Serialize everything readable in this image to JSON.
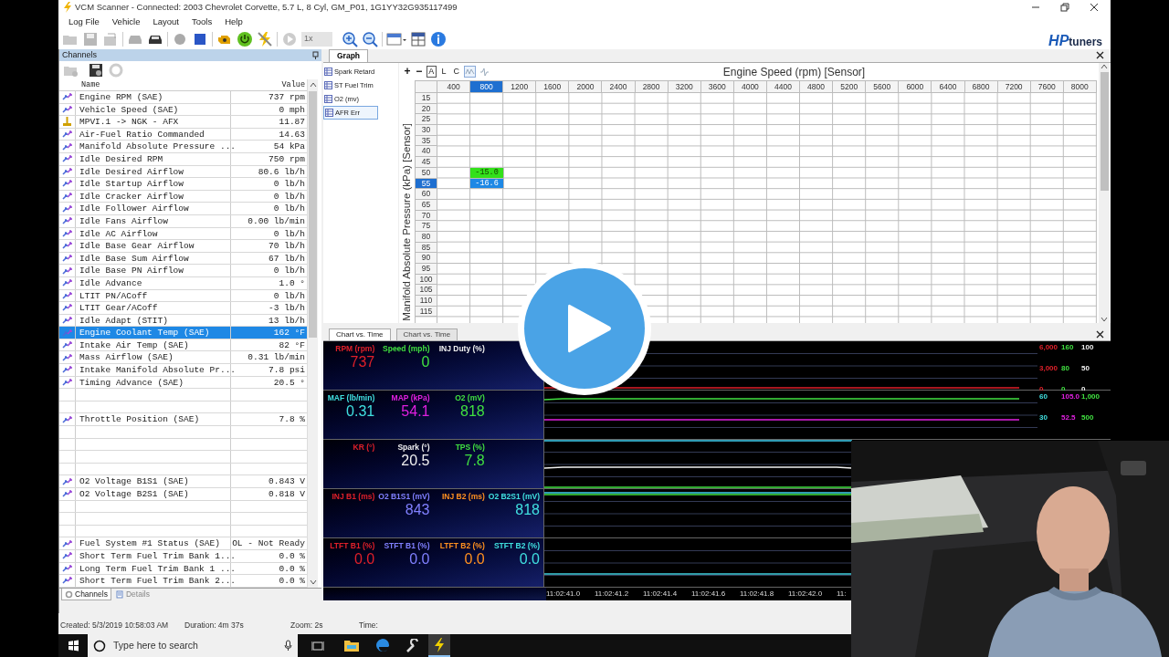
{
  "window": {
    "title": "VCM Scanner - Connected: 2003 Chevrolet Corvette, 5.7 L, 8 Cyl, GM_P01, 1G1YY32G935117499"
  },
  "menu": [
    "Log File",
    "Vehicle",
    "Layout",
    "Tools",
    "Help"
  ],
  "toolbar": {
    "playback_speed": {
      "value": "1x",
      "disabled": true
    }
  },
  "brand": {
    "prefix": "HP",
    "suffix": "tuners"
  },
  "channels_panel": {
    "title": "Channels",
    "columns": [
      "Name",
      "Value"
    ],
    "rows": [
      {
        "kind": "channel",
        "name": "Engine RPM (SAE)",
        "value": "737 rpm",
        "selected": false
      },
      {
        "kind": "channel",
        "name": "Vehicle Speed (SAE)",
        "value": "0 mph",
        "selected": false
      },
      {
        "kind": "probe",
        "name": "MPVI.1 -> NGK - AFX",
        "value": "11.87",
        "selected": false
      },
      {
        "kind": "channel",
        "name": "Air-Fuel Ratio Commanded",
        "value": "14.63",
        "selected": false
      },
      {
        "kind": "channel",
        "name": "Manifold Absolute Pressure ...",
        "value": "54 kPa",
        "selected": false
      },
      {
        "kind": "channel",
        "name": "Idle Desired RPM",
        "value": "750 rpm",
        "selected": false
      },
      {
        "kind": "channel",
        "name": "Idle Desired Airflow",
        "value": "80.6 lb/h",
        "selected": false
      },
      {
        "kind": "channel",
        "name": "Idle Startup Airflow",
        "value": "0 lb/h",
        "selected": false
      },
      {
        "kind": "channel",
        "name": "Idle Cracker Airflow",
        "value": "0 lb/h",
        "selected": false
      },
      {
        "kind": "channel",
        "name": "Idle Follower Airflow",
        "value": "0 lb/h",
        "selected": false
      },
      {
        "kind": "channel",
        "name": "Idle Fans Airflow",
        "value": "0.00 lb/min",
        "selected": false
      },
      {
        "kind": "channel",
        "name": "Idle AC Airflow",
        "value": "0 lb/h",
        "selected": false
      },
      {
        "kind": "channel",
        "name": "Idle Base Gear Airflow",
        "value": "70 lb/h",
        "selected": false
      },
      {
        "kind": "channel",
        "name": "Idle Base Sum Airflow",
        "value": "67 lb/h",
        "selected": false
      },
      {
        "kind": "channel",
        "name": "Idle Base PN Airflow",
        "value": "0 lb/h",
        "selected": false
      },
      {
        "kind": "channel",
        "name": "Idle Advance",
        "value": "1.0 °",
        "selected": false
      },
      {
        "kind": "channel",
        "name": "LTIT PN/ACoff",
        "value": "0 lb/h",
        "selected": false
      },
      {
        "kind": "channel",
        "name": "LTIT Gear/ACoff",
        "value": "-3 lb/h",
        "selected": false
      },
      {
        "kind": "channel",
        "name": "Idle Adapt (STIT)",
        "value": "13 lb/h",
        "selected": false
      },
      {
        "kind": "channel",
        "name": "Engine Coolant Temp (SAE)",
        "value": "162 °F",
        "selected": true
      },
      {
        "kind": "channel",
        "name": "Intake Air Temp (SAE)",
        "value": "82 °F",
        "selected": false
      },
      {
        "kind": "channel",
        "name": "Mass Airflow (SAE)",
        "value": "0.31 lb/min",
        "selected": false
      },
      {
        "kind": "channel",
        "name": "Intake Manifold Absolute Pr...",
        "value": "7.8 psi",
        "selected": false
      },
      {
        "kind": "channel",
        "name": "Timing Advance (SAE)",
        "value": "20.5 °",
        "selected": false
      },
      {
        "kind": "blank",
        "selected": false
      },
      {
        "kind": "blank",
        "selected": false
      },
      {
        "kind": "channel",
        "name": "Throttle Position (SAE)",
        "value": "7.8 %",
        "selected": false
      },
      {
        "kind": "blank",
        "selected": false
      },
      {
        "kind": "blank",
        "selected": false
      },
      {
        "kind": "blank",
        "selected": false
      },
      {
        "kind": "blank",
        "selected": false
      },
      {
        "kind": "channel",
        "name": "O2 Voltage B1S1 (SAE)",
        "value": "0.843 V",
        "selected": false
      },
      {
        "kind": "channel",
        "name": "O2 Voltage B2S1 (SAE)",
        "value": "0.818 V",
        "selected": false
      },
      {
        "kind": "blank",
        "selected": false
      },
      {
        "kind": "blank",
        "selected": false
      },
      {
        "kind": "blank",
        "selected": false
      },
      {
        "kind": "channel",
        "name": "Fuel System #1 Status (SAE)",
        "value": "OL - Not Ready",
        "selected": false
      },
      {
        "kind": "channel",
        "name": "Short Term Fuel Trim Bank 1...",
        "value": "0.0 %",
        "selected": false
      },
      {
        "kind": "channel",
        "name": "Long Term Fuel Trim Bank 1 ...",
        "value": "0.0 %",
        "selected": false
      },
      {
        "kind": "channel",
        "name": "Short Term Fuel Trim Bank 2...",
        "value": "0.0 %",
        "selected": false
      }
    ],
    "tabs": [
      {
        "label": "Channels",
        "selected": true
      },
      {
        "label": "Details",
        "selected": false
      }
    ]
  },
  "graph_panel": {
    "tab": "Graph",
    "tables": [
      {
        "label": "Spark Retard",
        "selected": false
      },
      {
        "label": "ST Fuel Trim",
        "selected": false
      },
      {
        "label": "O2 (mv)",
        "selected": false
      },
      {
        "label": "AFR Err",
        "selected": true
      }
    ],
    "zoom_buttons": [
      "+",
      "−"
    ],
    "modes": [
      {
        "label": "A",
        "selected": true
      },
      {
        "label": "L",
        "selected": false
      },
      {
        "label": "C",
        "selected": false
      }
    ],
    "trace_toggles": [
      {
        "selected": true
      },
      {
        "selected": false
      }
    ],
    "title": "Engine Speed (rpm) [Sensor]",
    "y_axis_label": "Manifold Absolute Pressure (kPa) [Sensor]",
    "columns": [
      {
        "label": "400",
        "selected": false
      },
      {
        "label": "800",
        "selected": true
      },
      {
        "label": "1200",
        "selected": false
      },
      {
        "label": "1600",
        "selected": false
      },
      {
        "label": "2000",
        "selected": false
      },
      {
        "label": "2400",
        "selected": false
      },
      {
        "label": "2800",
        "selected": false
      },
      {
        "label": "3200",
        "selected": false
      },
      {
        "label": "3600",
        "selected": false
      },
      {
        "label": "4000",
        "selected": false
      },
      {
        "label": "4400",
        "selected": false
      },
      {
        "label": "4800",
        "selected": false
      },
      {
        "label": "5200",
        "selected": false
      },
      {
        "label": "5600",
        "selected": false
      },
      {
        "label": "6000",
        "selected": false
      },
      {
        "label": "6400",
        "selected": false
      },
      {
        "label": "6800",
        "selected": false
      },
      {
        "label": "7200",
        "selected": false
      },
      {
        "label": "7600",
        "selected": false
      },
      {
        "label": "8000",
        "selected": false
      }
    ],
    "rows": [
      {
        "label": "15",
        "selected": false
      },
      {
        "label": "20",
        "selected": false
      },
      {
        "label": "25",
        "selected": false
      },
      {
        "label": "30",
        "selected": false
      },
      {
        "label": "35",
        "selected": false
      },
      {
        "label": "40",
        "selected": false
      },
      {
        "label": "45",
        "selected": false
      },
      {
        "label": "50",
        "selected": false,
        "cells": [
          null,
          {
            "value": "-15.0",
            "color": "#33e01a"
          }
        ]
      },
      {
        "label": "55",
        "selected": true,
        "cells": [
          null,
          {
            "value": "-16.6"
          }
        ]
      },
      {
        "label": "60",
        "selected": false
      },
      {
        "label": "65",
        "selected": false
      },
      {
        "label": "70",
        "selected": false
      },
      {
        "label": "75",
        "selected": false
      },
      {
        "label": "80",
        "selected": false
      },
      {
        "label": "85",
        "selected": false
      },
      {
        "label": "90",
        "selected": false
      },
      {
        "label": "95",
        "selected": false
      },
      {
        "label": "100",
        "selected": false
      },
      {
        "label": "105",
        "selected": false
      },
      {
        "label": "110",
        "selected": false
      },
      {
        "label": "115",
        "selected": false
      }
    ]
  },
  "chart_panel": {
    "tabs": [
      {
        "label": "Chart vs. Time",
        "selected": true
      },
      {
        "label": "Chart vs. Time",
        "selected": false
      }
    ],
    "rows": [
      {
        "gauges": [
          {
            "label": "RPM (rpm)",
            "value": "737",
            "color": "#e0202a"
          },
          {
            "label": "Speed (mph)",
            "value": "0",
            "color": "#40e040"
          },
          {
            "label": "INJ Duty (%)",
            "color": "#f0f0f0"
          }
        ],
        "scale": [
          [
            {
              "text": "6,000",
              "color": "#e0202a"
            },
            {
              "text": "160",
              "color": "#40e040"
            },
            {
              "text": "100",
              "color": "#f0f0f0"
            }
          ],
          [
            {
              "text": "3,000",
              "color": "#e0202a"
            },
            {
              "text": "80",
              "color": "#40e040"
            },
            {
              "text": "50",
              "color": "#f0f0f0"
            }
          ],
          [
            {
              "text": "0",
              "color": "#e0202a"
            },
            {
              "text": "0",
              "color": "#40e040"
            },
            {
              "text": "0",
              "color": "#f0f0f0"
            }
          ]
        ]
      },
      {
        "gauges": [
          {
            "label": "MAF (lb/min)",
            "value": "0.31",
            "color": "#40e0e0"
          },
          {
            "label": "MAP (kPa)",
            "value": "54.1",
            "color": "#e020e0"
          },
          {
            "label": "O2 (mV)",
            "value": "818",
            "color": "#40e040"
          }
        ],
        "scale": [
          [
            {
              "text": "60",
              "color": "#40e0e0"
            },
            {
              "text": "105.0",
              "color": "#e020e0"
            },
            {
              "text": "1,000",
              "color": "#40e040"
            }
          ],
          [
            {
              "text": "30",
              "color": "#40e0e0"
            },
            {
              "text": "52.5",
              "color": "#e020e0"
            },
            {
              "text": "500",
              "color": "#40e040"
            }
          ]
        ]
      },
      {
        "gauges": [
          {
            "label": "KR (°)",
            "color": "#e0202a"
          },
          {
            "label": "Spark (°)",
            "value": "20.5",
            "color": "#f0f0f0"
          },
          {
            "label": "TPS (%)",
            "value": "7.8",
            "color": "#40e040"
          }
        ]
      },
      {
        "gauges": [
          {
            "label": "INJ B1 (ms)",
            "color": "#e0202a"
          },
          {
            "label": "O2 B1S1 (mV)",
            "value": "843",
            "color": "#8080ff"
          },
          {
            "label": "INJ B2 (ms)",
            "color": "#ff9020"
          },
          {
            "label": "O2 B2S1 (mV)",
            "value": "818",
            "color": "#40e0e0"
          }
        ]
      },
      {
        "gauges": [
          {
            "label": "LTFT B1 (%)",
            "value": "0.0",
            "color": "#e0202a"
          },
          {
            "label": "STFT B1 (%)",
            "value": "0.0",
            "color": "#8080ff"
          },
          {
            "label": "LTFT B2 (%)",
            "value": "0.0",
            "color": "#ff9020"
          },
          {
            "label": "STFT B2 (%)",
            "value": "0.0",
            "color": "#40e0e0"
          }
        ]
      }
    ],
    "time_labels": [
      "11:02:41.0",
      "11:02:41.2",
      "11:02:41.4",
      "11:02:41.6",
      "11:02:41.8",
      "11:02:42.0",
      "11:"
    ]
  },
  "status_bar": [
    "Created: 5/3/2019 10:58:03 AM",
    "Duration: 4m 37s",
    "Zoom: 2s",
    "Time:"
  ],
  "taskbar": {
    "search": {
      "placeholder": "Type here to search"
    }
  }
}
